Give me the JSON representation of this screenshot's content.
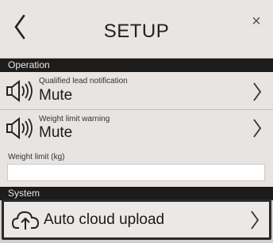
{
  "header": {
    "title": "SETUP",
    "back_icon": "chevron-left-icon",
    "close_icon": "close-icon",
    "close_glyph": "×"
  },
  "sections": {
    "operation": "Operation",
    "system": "System"
  },
  "operation": {
    "items": [
      {
        "title": "Qualified lead notification",
        "value": "Mute",
        "icon": "speaker-mute-icon"
      },
      {
        "title": "Weight limit warning",
        "value": "Mute",
        "icon": "speaker-mute-icon"
      }
    ],
    "weight_limit": {
      "label": "Weight limit (kg)",
      "value": ""
    }
  },
  "system": {
    "auto_cloud_upload": {
      "label": "Auto cloud upload",
      "icon": "cloud-upload-icon"
    }
  },
  "colors": {
    "background": "#d3cfcb",
    "section_bar": "#1c1c1c",
    "row": "#e7e4e1"
  }
}
